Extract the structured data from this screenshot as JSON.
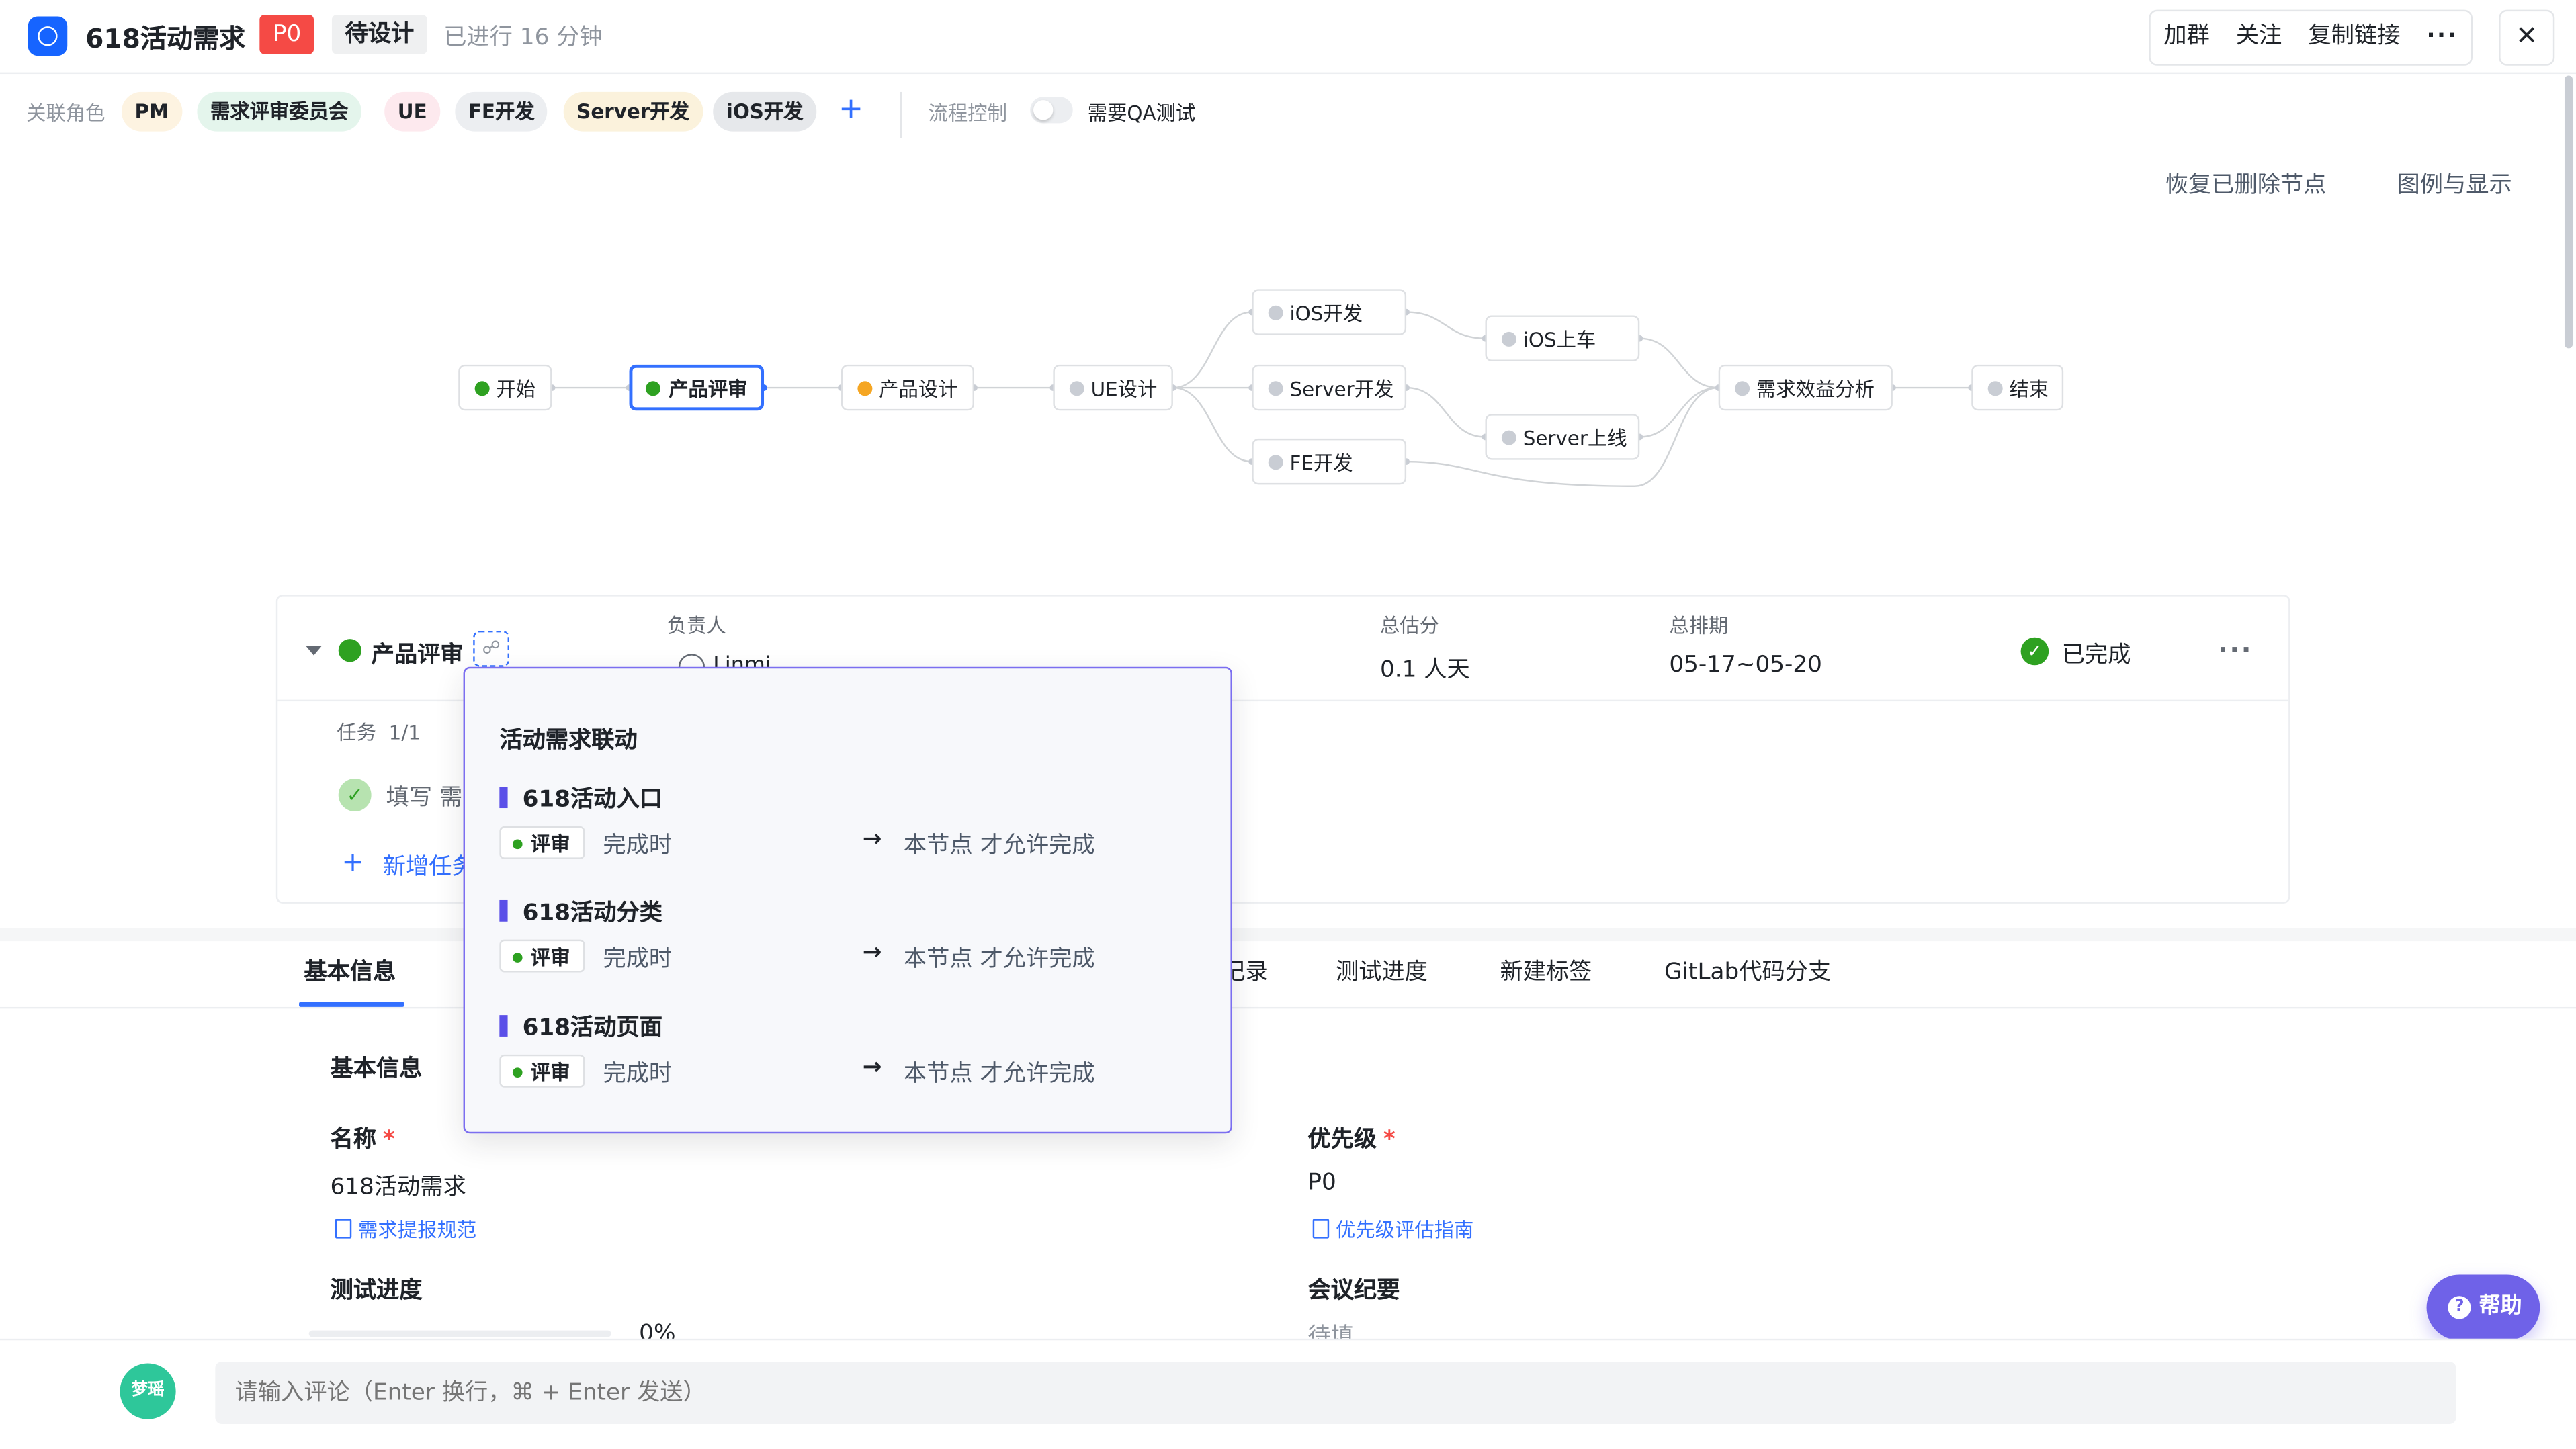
{
  "header": {
    "title": "618活动需求",
    "priority_badge": "P0",
    "status_badge": "待设计",
    "elapsed": "已进行 16 分钟",
    "actions": [
      "加群",
      "关注",
      "复制链接"
    ],
    "more": "···",
    "close": "✕"
  },
  "roles": {
    "label": "关联角色",
    "items": [
      "PM",
      "需求评审委员会",
      "UE",
      "FE开发",
      "Server开发",
      "iOS开发"
    ],
    "add": "+",
    "flow_control_label": "流程控制",
    "qa_toggle_label": "需要QA测试",
    "qa_toggle_on": false
  },
  "toolbar": {
    "restore_deleted": "恢复已删除节点",
    "legend": "图例与显示"
  },
  "flow": {
    "nodes": [
      {
        "id": "start",
        "label": "开始",
        "status_color": "#2ea121"
      },
      {
        "id": "review",
        "label": "产品评审",
        "status_color": "#2ea121",
        "active": true
      },
      {
        "id": "design",
        "label": "产品设计",
        "status_color": "#f5a623"
      },
      {
        "id": "ue",
        "label": "UE设计",
        "status_color": "#c9cdd4"
      },
      {
        "id": "ios_dev",
        "label": "iOS开发",
        "status_color": "#c9cdd4"
      },
      {
        "id": "server_dev",
        "label": "Server开发",
        "status_color": "#c9cdd4"
      },
      {
        "id": "fe_dev",
        "label": "FE开发",
        "status_color": "#c9cdd4"
      },
      {
        "id": "ios_launch",
        "label": "iOS上车",
        "status_color": "#c9cdd4"
      },
      {
        "id": "server_launch",
        "label": "Server上线",
        "status_color": "#c9cdd4"
      },
      {
        "id": "analysis",
        "label": "需求效益分析",
        "status_color": "#c9cdd4"
      },
      {
        "id": "end",
        "label": "结束",
        "status_color": "#c9cdd4"
      }
    ]
  },
  "node_card": {
    "name": "产品评审",
    "owner_label": "负责人",
    "owner_name": "Linmi",
    "estimate_label": "总估分",
    "estimate_value": "0.1 人天",
    "schedule_label": "总排期",
    "schedule_value": "05-17~05-20",
    "status": "已完成",
    "more": "···",
    "tasks_label": "任务",
    "tasks_count": "1/1",
    "task_text": "填写 需求",
    "new_task": "新增任务"
  },
  "popover": {
    "title": "活动需求联动",
    "items": [
      {
        "name": "618活动入口",
        "tag": "评审",
        "when": "完成时",
        "result": "本节点 才允许完成"
      },
      {
        "name": "618活动分类",
        "tag": "评审",
        "when": "完成时",
        "result": "本节点 才允许完成"
      },
      {
        "name": "618活动页面",
        "tag": "评审",
        "when": "完成时",
        "result": "本节点 才允许完成"
      }
    ]
  },
  "tabs": [
    "基本信息",
    "记录",
    "测试进度",
    "新建标签",
    "GitLab代码分支"
  ],
  "basic_info": {
    "section_title": "基本信息",
    "name_label": "名称",
    "name_value": "618活动需求",
    "name_link": "需求提报规范",
    "priority_label": "优先级",
    "priority_value": "P0",
    "priority_link": "优先级评估指南",
    "test_progress_label": "测试进度",
    "test_progress_value": "0%",
    "test_progress_fraction": 0,
    "meeting_label": "会议纪要",
    "meeting_value": "待填"
  },
  "comment": {
    "avatar_text": "梦瑶",
    "placeholder": "请输入评论（Enter 换行，⌘ + Enter 发送）"
  },
  "help": {
    "label": "帮助",
    "icon": "?"
  },
  "colors": {
    "accent": "#3370ff",
    "success": "#2ea121",
    "danger": "#f54a45",
    "popover_border": "#7b6ef0",
    "help_bg": "#6f62e8"
  }
}
